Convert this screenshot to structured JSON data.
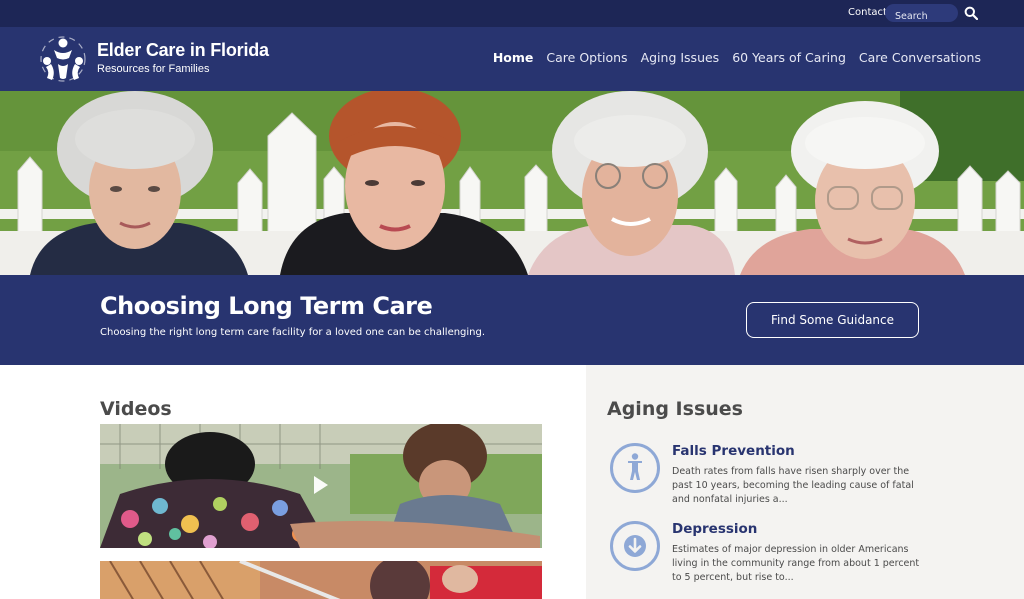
{
  "topbar": {
    "contact_label": "Contact",
    "search_placeholder": "Search",
    "search_icon": "magnifier-icon"
  },
  "header": {
    "brand_title": "Elder Care in Florida",
    "brand_subtitle": "Resources for Families",
    "logo_icon": "people-circle-logo"
  },
  "nav": {
    "items": [
      {
        "label": "Home",
        "active": true
      },
      {
        "label": "Care Options",
        "active": false
      },
      {
        "label": "Aging Issues",
        "active": false
      },
      {
        "label": "60 Years of Caring",
        "active": false
      },
      {
        "label": "Care Conversations",
        "active": false
      }
    ]
  },
  "banner": {
    "title": "Choosing Long Term Care",
    "subtitle": "Choosing the right long term care facility for a loved one can be challenging.",
    "button_label": "Find Some Guidance"
  },
  "videos": {
    "heading": "Videos",
    "play_icon": "play-icon"
  },
  "aging_issues": {
    "heading": "Aging Issues",
    "items": [
      {
        "title": "Falls Prevention",
        "description": "Death rates from falls have risen sharply over the past 10 years, becoming the leading cause of fatal and nonfatal injuries a...",
        "icon": "person-standing-icon"
      },
      {
        "title": "Depression",
        "description": "Estimates of major depression in older Americans living in the community range from about 1 percent to 5 percent, but rise to...",
        "icon": "arrow-down-circle-icon"
      }
    ]
  },
  "colors": {
    "topbar": "#1d2656",
    "header": "#283470",
    "accent_link": "#283470",
    "icon_ring": "#8ea8d6",
    "right_panel_bg": "#f4f3f1"
  }
}
